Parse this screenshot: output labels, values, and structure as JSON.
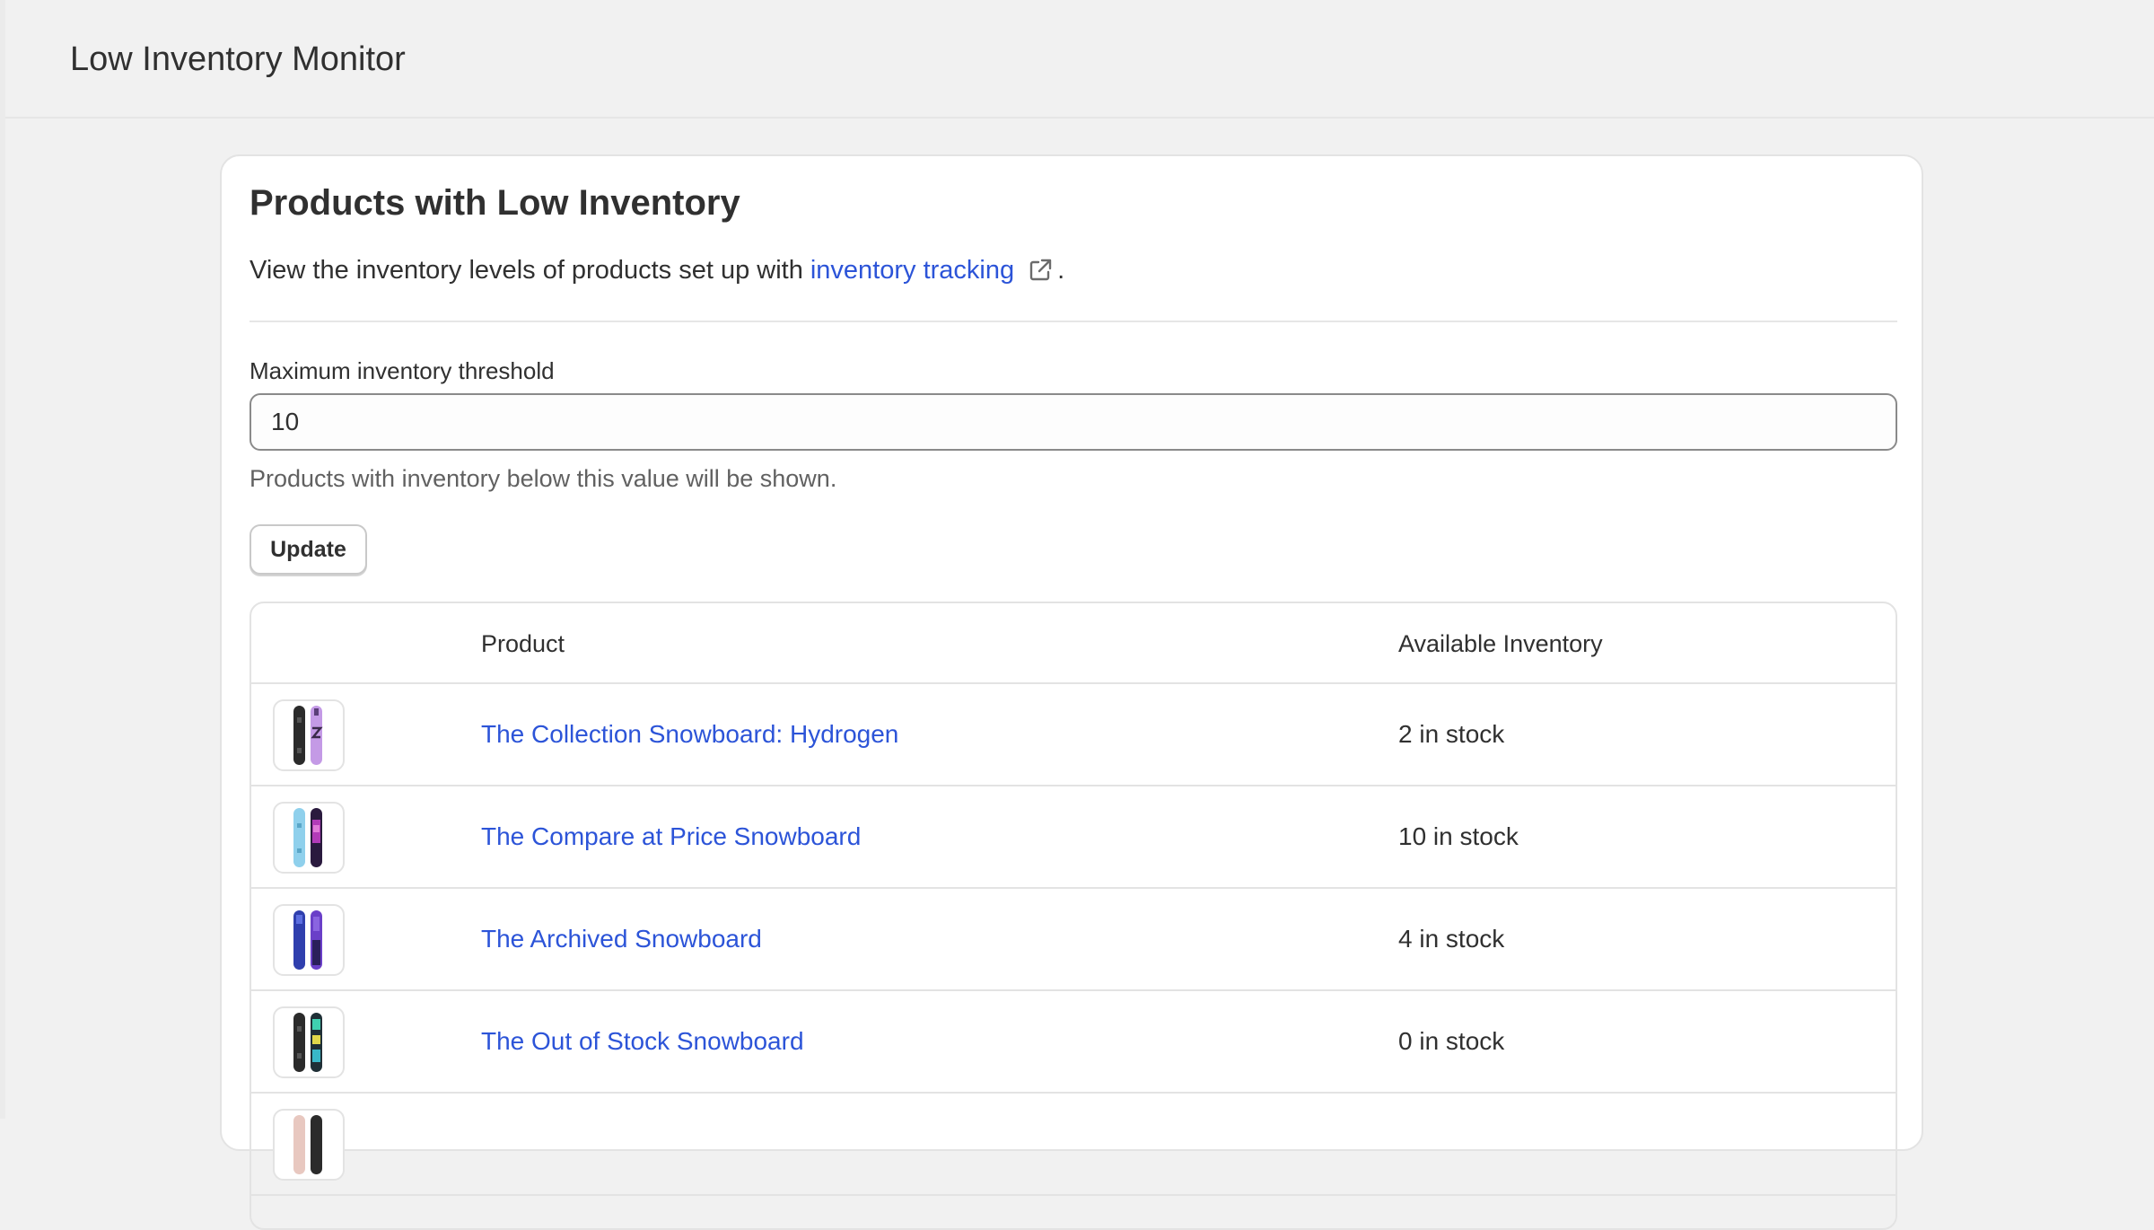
{
  "app": {
    "title": "Low Inventory Monitor"
  },
  "card": {
    "title": "Products with Low Inventory",
    "description": "View the inventory levels of products set up with",
    "link_text": "inventory tracking",
    "description_end": "."
  },
  "threshold": {
    "label": "Maximum inventory threshold",
    "value": "10",
    "help": "Products with inventory below this value will be shown."
  },
  "update_button": {
    "label": "Update"
  },
  "table": {
    "headers": {
      "product": "Product",
      "inventory": "Available Inventory"
    },
    "rows": [
      {
        "product": "The Collection Snowboard: Hydrogen",
        "stock": "2 in stock",
        "thumb": "snowboard-black-lilac"
      },
      {
        "product": "The Compare at Price Snowboard",
        "stock": "10 in stock",
        "thumb": "snowboard-skyblue-purple"
      },
      {
        "product": "The Archived Snowboard",
        "stock": "4 in stock",
        "thumb": "snowboard-blue-violet"
      },
      {
        "product": "The Out of Stock Snowboard",
        "stock": "0 in stock",
        "thumb": "snowboard-black-teal"
      },
      {
        "product": "",
        "stock": "",
        "thumb": "snowboard-partial"
      }
    ]
  },
  "colors": {
    "link": "#2c54d8",
    "background": "#f1f1f1",
    "text": "#303030"
  }
}
